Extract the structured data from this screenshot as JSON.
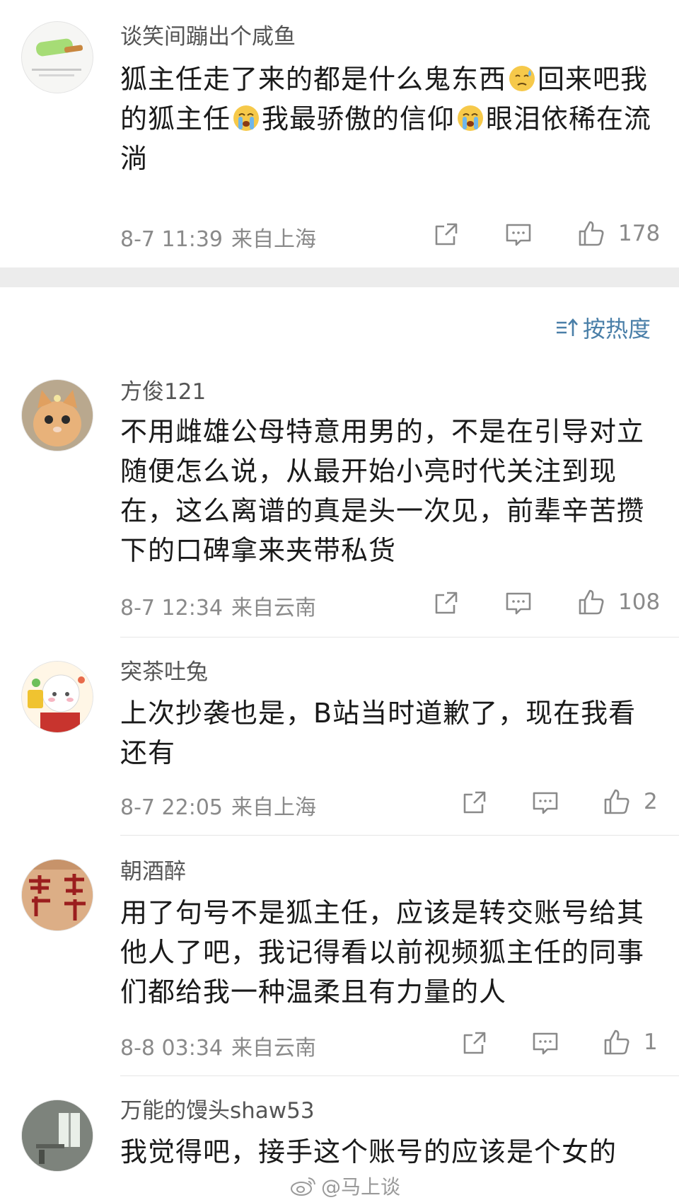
{
  "comments": [
    {
      "username": "谈笑间蹦出个咸鱼",
      "content_parts": [
        "狐主任走了来的都是什么鬼东西",
        "回来吧我的狐主任",
        "我最骄傲的信仰",
        "眼泪依稀在流淌"
      ],
      "emojis": [
        "sweat-face-emoji",
        "crying-face-emoji",
        "crying-face-emoji"
      ],
      "time": "8-7 11:39",
      "location": "来自上海",
      "likes": "178"
    },
    {
      "username": "方俊121",
      "content": "不用雌雄公母特意用男的，不是在引导对立随便怎么说，从最开始小亮时代关注到现在，这么离谱的真是头一次见，前辈辛苦攒下的口碑拿来夹带私货",
      "time": "8-7 12:34",
      "location": "来自云南",
      "likes": "108"
    },
    {
      "username": "突茶吐兔",
      "content": "上次抄袭也是，B站当时道歉了，现在我看还有",
      "time": "8-7 22:05",
      "location": "来自上海",
      "likes": "2"
    },
    {
      "username": "朝酒醉",
      "content": "用了句号不是狐主任，应该是转交账号给其他人了吧，我记得看以前视频狐主任的同事们都给我一种温柔且有力量的人",
      "time": "8-8 03:34",
      "location": "来自云南",
      "likes": "1"
    },
    {
      "username": "万能的馒头shaw53",
      "content": "我觉得吧，接手这个账号的应该是个女的"
    }
  ],
  "sort_label": "按热度",
  "watermark": "@马上谈",
  "colors": {
    "accent": "#4a7fa8",
    "meta_text": "#8a8a8a",
    "divider": "#ececec"
  }
}
